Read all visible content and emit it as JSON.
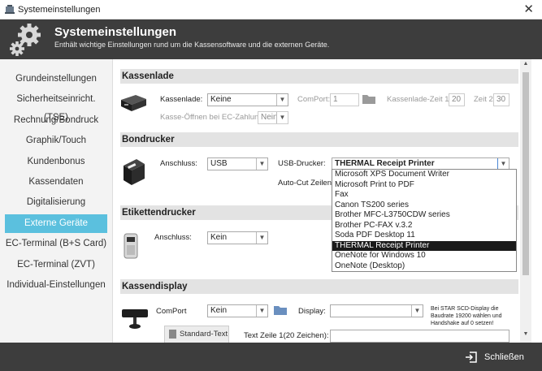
{
  "window": {
    "title": "Systemeinstellungen",
    "close_glyph": "✕"
  },
  "header": {
    "title": "Systemeinstellungen",
    "subtitle": "Enthält wichtige Einstellungen rund um die Kassensoftware und die externen Geräte."
  },
  "sidebar": {
    "items": [
      {
        "label": "Grundeinstellungen",
        "active": false
      },
      {
        "label": "Sicherheitseinricht. (TSE)",
        "active": false
      },
      {
        "label": "Rechnung/Bondruck",
        "active": false
      },
      {
        "label": "Graphik/Touch",
        "active": false
      },
      {
        "label": "Kundenbonus",
        "active": false
      },
      {
        "label": "Kassendaten",
        "active": false
      },
      {
        "label": "Digitalisierung",
        "active": false
      },
      {
        "label": "Externe Geräte",
        "active": true
      },
      {
        "label": "EC-Terminal (B+S Card)",
        "active": false
      },
      {
        "label": "EC-Terminal (ZVT)",
        "active": false
      },
      {
        "label": "Individual-Einstellungen",
        "active": false
      }
    ],
    "active_color": "#5bc0de"
  },
  "kassenlade": {
    "heading": "Kassenlade",
    "label": "Kassenlade:",
    "value": "Keine",
    "comport_label": "ComPort:",
    "comport_value": "1",
    "zeit1_label": "Kassenlade-Zeit 1:",
    "zeit1_value": "20",
    "zeit2_label": "Zeit 2:",
    "zeit2_value": "30",
    "ec_label": "Kasse-Öffnen bei EC-Zahlung:",
    "ec_value": "Nein"
  },
  "bondrucker": {
    "heading": "Bondrucker",
    "anschluss_label": "Anschluss:",
    "anschluss_value": "USB",
    "usb_label": "USB-Drucker:",
    "usb_value": "THERMAL Receipt Printer",
    "autocut_label": "Auto-Cut Zeilen:",
    "options": [
      "Microsoft XPS Document Writer",
      "Microsoft Print to PDF",
      "Fax",
      "Canon TS200 series",
      "Brother MFC-L3750CDW series",
      "Brother PC-FAX v.3.2",
      "Soda PDF Desktop 11",
      "THERMAL Receipt Printer",
      "OneNote for Windows 10",
      "OneNote (Desktop)"
    ],
    "selected_index": 7
  },
  "etikettendrucker": {
    "heading": "Etikettendrucker",
    "anschluss_label": "Anschluss:",
    "anschluss_value": "Kein"
  },
  "kassendisplay": {
    "heading": "Kassendisplay",
    "comport_label": "ComPort",
    "comport_value": "Kein",
    "display_label": "Display:",
    "display_value": "",
    "note": "Bei STAR SCD-Display die Baudrate 19200 wählen und Handshake auf 0 setzen!",
    "standard_button": "Standard-Text",
    "zeile1_label": "Text Zeile 1(20 Zeichen):",
    "zeile1_value": ""
  },
  "footer": {
    "exit_label": "Schließen"
  }
}
